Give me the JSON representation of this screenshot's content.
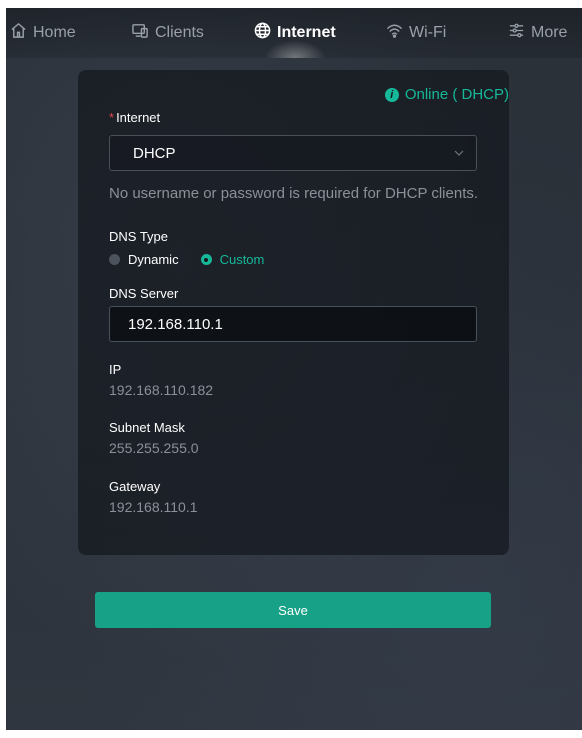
{
  "nav": {
    "items": [
      {
        "label": "Home",
        "icon": "home-icon"
      },
      {
        "label": "Clients",
        "icon": "clients-icon"
      },
      {
        "label": "Internet",
        "icon": "globe-icon",
        "active": true
      },
      {
        "label": "Wi-Fi",
        "icon": "wifi-icon"
      },
      {
        "label": "More",
        "icon": "more-icon"
      }
    ]
  },
  "card": {
    "status": "Online ( DHCP)",
    "internet_label": "Internet",
    "internet_value": "DHCP",
    "hint": "No username or password is required for DHCP clients.",
    "dns_type_label": "DNS Type",
    "dns_type_options": [
      "Dynamic",
      "Custom"
    ],
    "dns_type_selected": "Custom",
    "dns_server_label": "DNS Server",
    "dns_server_value": "192.168.110.1",
    "ip_label": "IP",
    "ip_value": "192.168.110.182",
    "subnet_label": "Subnet Mask",
    "subnet_value": "255.255.255.0",
    "gateway_label": "Gateway",
    "gateway_value": "192.168.110.1"
  },
  "actions": {
    "save_label": "Save"
  },
  "colors": {
    "accent": "#16b89a",
    "required": "#e0464b",
    "button": "#17a287"
  }
}
